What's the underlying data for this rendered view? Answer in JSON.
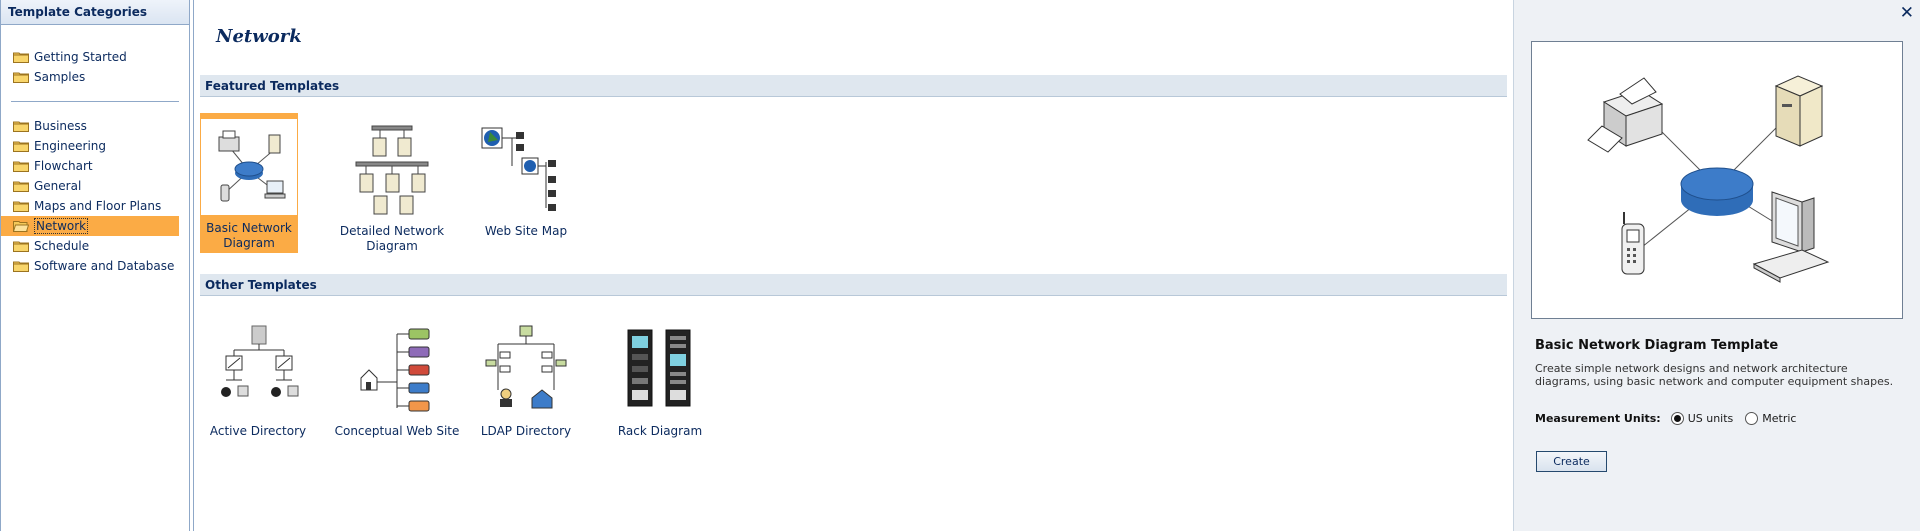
{
  "sidebar": {
    "header": "Template Categories",
    "group1": [
      "Getting Started",
      "Samples"
    ],
    "group2": [
      "Business",
      "Engineering",
      "Flowchart",
      "General",
      "Maps and Floor Plans",
      "Network",
      "Schedule",
      "Software and Database"
    ],
    "selected": "Network"
  },
  "main": {
    "title": "Network",
    "featured_label": "Featured Templates",
    "featured": [
      "Basic Network Diagram",
      "Detailed Network Diagram",
      "Web Site Map"
    ],
    "other_label": "Other Templates",
    "other": [
      "Active Directory",
      "Conceptual Web Site",
      "LDAP Directory",
      "Rack Diagram"
    ]
  },
  "preview": {
    "close_glyph": "✕",
    "title": "Basic Network Diagram Template",
    "description": "Create simple network designs and network architecture diagrams, using basic network and computer equipment shapes.",
    "units_label": "Measurement Units:",
    "unit_options": [
      "US units",
      "Metric"
    ],
    "selected_unit": "US units",
    "create_label": "Create"
  },
  "colors": {
    "selection": "#fbab45",
    "header_text": "#0b2a5e",
    "section_bg": "#dfe7ef",
    "hub_blue": "#3d7cc9"
  },
  "icons": [
    "folder-icon",
    "open-folder-icon",
    "close-icon",
    "radio-button-icon"
  ]
}
